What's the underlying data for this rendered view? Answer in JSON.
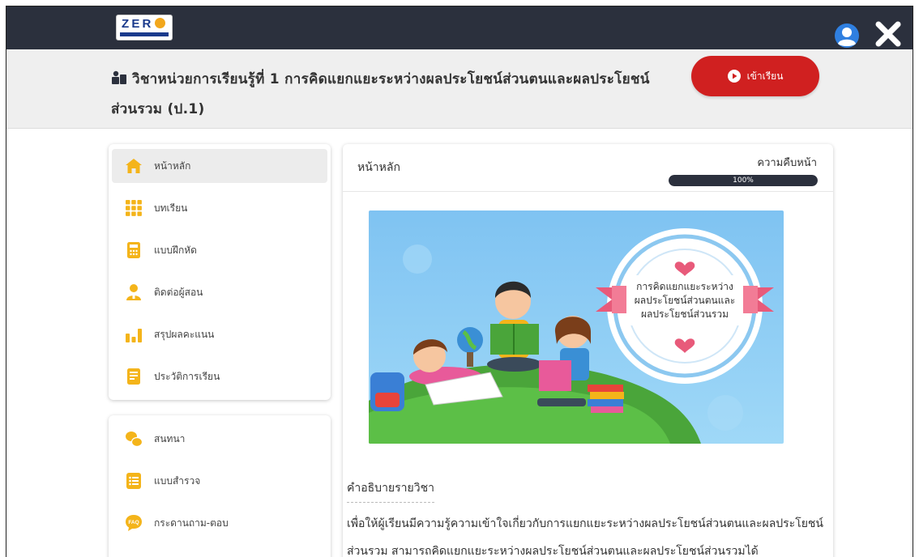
{
  "brand": {
    "logo_text": "ZERO"
  },
  "header": {
    "course_title": "วิชาหน่วยการเรียนรู้ที่ 1 การคิดแยกแยะระหว่างผลประโยชน์ส่วนตนและผลประโยชน์ส่วนรวม (ป.1)",
    "enter_button_label": "เข้าเรียน"
  },
  "sidebar": {
    "main_items": [
      {
        "label": "หน้าหลัก",
        "icon": "home-icon",
        "color": "#f4b41a"
      },
      {
        "label": "บทเรียน",
        "icon": "grid-icon",
        "color": "#f4b41a"
      },
      {
        "label": "แบบฝึกหัด",
        "icon": "calculator-icon",
        "color": "#f4b41a"
      },
      {
        "label": "ติดต่อผู้สอน",
        "icon": "person-icon",
        "color": "#f4b41a"
      },
      {
        "label": "สรุปผลคะแนน",
        "icon": "bar-chart-icon",
        "color": "#f4b41a"
      },
      {
        "label": "ประวัติการเรียน",
        "icon": "history-icon",
        "color": "#f4b41a"
      }
    ],
    "extra_items": [
      {
        "label": "สนทนา",
        "icon": "chat-icon",
        "color": "#f4b41a"
      },
      {
        "label": "แบบสำรวจ",
        "icon": "survey-icon",
        "color": "#f4b41a"
      },
      {
        "label": "กระดานถาม-ตอบ",
        "icon": "faq-icon",
        "icon_text": "FAQ",
        "color": "#f4b41a"
      }
    ]
  },
  "content": {
    "title": "หน้าหลัก",
    "progress_label": "ความคืบหน้า",
    "progress_value": 100,
    "progress_text": "100%",
    "banner_text": "การคิดแยกแยะระหว่าง ผลประโยชน์ส่วนตนและ ผลประโยชน์ส่วนรวม",
    "description_heading": "คำอธิบายรายวิชา",
    "description_text": "เพื่อให้ผู้เรียนมีความรู้ความเข้าใจเกี่ยวกับการแยกแยะระหว่างผลประโยชน์ส่วนตนและผลประโยชน์ส่วนรวม สามารถคิดแยกแยะระหว่างผลประโยชน์ส่วนตนและผลประโยชน์ส่วนรวมได้"
  },
  "colors": {
    "topbar": "#2b303d",
    "accent_red": "#d02020",
    "icon_yellow": "#f4b41a",
    "user_blue": "#2f7fe0"
  }
}
